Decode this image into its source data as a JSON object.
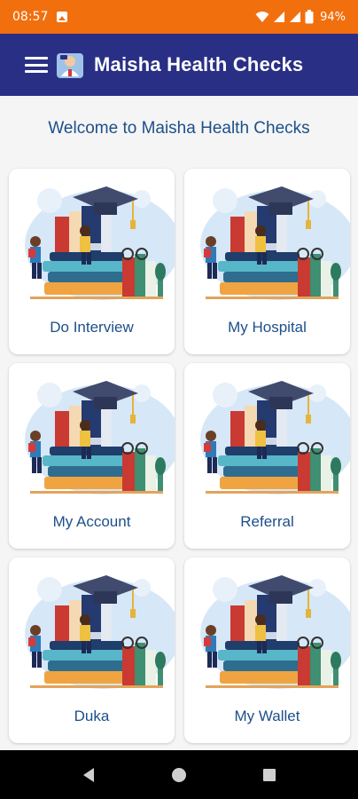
{
  "status_bar": {
    "time": "08:57",
    "battery": "94%"
  },
  "app_bar": {
    "title": "Maisha Health Checks"
  },
  "welcome": "Welcome to Maisha Health Checks",
  "tiles": [
    {
      "label": "Do Interview"
    },
    {
      "label": "My Hospital"
    },
    {
      "label": "My Account"
    },
    {
      "label": "Referral"
    },
    {
      "label": "Duka"
    },
    {
      "label": "My Wallet"
    }
  ],
  "icons": {
    "menu": "hamburger-icon",
    "logo": "doctor-logo-icon",
    "tile_illustration": "books-graduation-illustration",
    "nav_back": "triangle-back-icon",
    "nav_home": "circle-home-icon",
    "nav_recents": "square-recents-icon"
  },
  "colors": {
    "status_bar": "#f26f0e",
    "app_bar": "#2a2f86",
    "text_accent": "#1d4f8a"
  }
}
